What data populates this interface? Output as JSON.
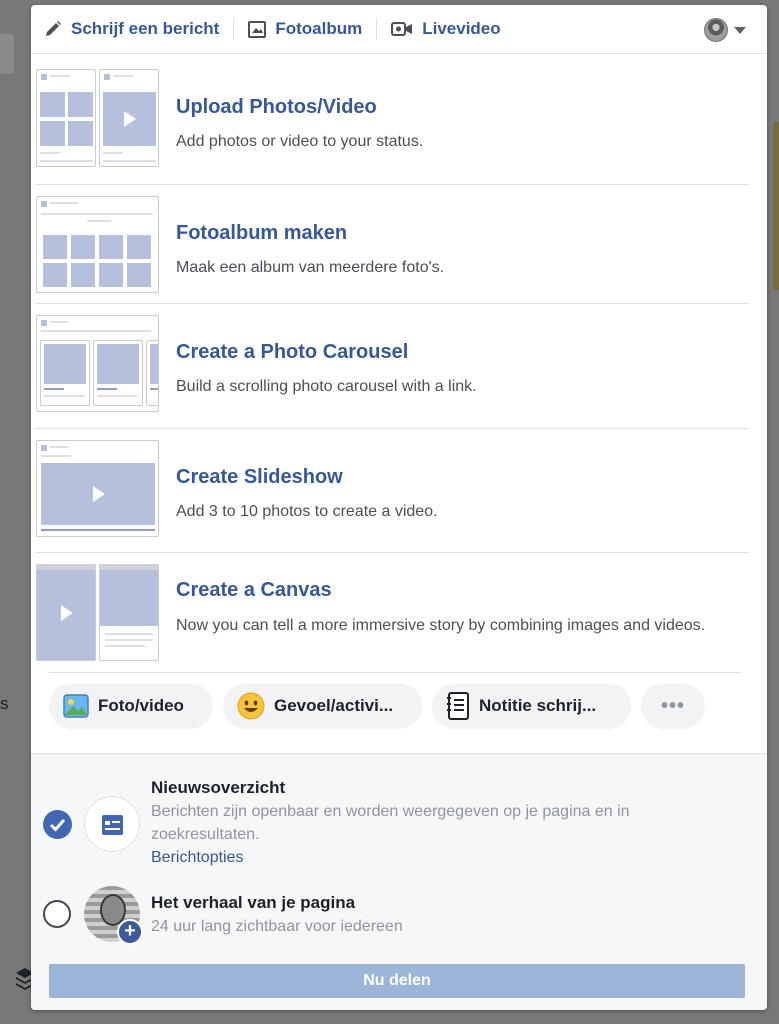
{
  "tabs": [
    {
      "label": "Schrijf een bericht",
      "icon": "pencil-icon"
    },
    {
      "label": "Fotoalbum",
      "icon": "photo-icon"
    },
    {
      "label": "Livevideo",
      "icon": "video-camera-icon"
    }
  ],
  "options": [
    {
      "title": "Upload Photos/Video",
      "description": "Add photos or video to your status."
    },
    {
      "title": "Fotoalbum maken",
      "description": "Maak een album van meerdere foto's."
    },
    {
      "title": "Create a Photo Carousel",
      "description": "Build a scrolling photo carousel with a link."
    },
    {
      "title": "Create Slideshow",
      "description": "Add 3 to 10 photos to create a video."
    },
    {
      "title": "Create a Canvas",
      "description": "Now you can tell a more immersive story by combining images and videos."
    }
  ],
  "pills": [
    {
      "label": "Foto/video",
      "icon": "photo-landscape-icon"
    },
    {
      "label": "Gevoel/activi...",
      "icon": "smiley-icon"
    },
    {
      "label": "Notitie schrij...",
      "icon": "notebook-icon"
    },
    {
      "label": "•••",
      "icon": "more-icon"
    }
  ],
  "destinations": {
    "feed": {
      "title": "Nieuwsoverzicht",
      "description": "Berichten zijn openbaar en worden weergegeven op je pagina en in zoekresultaten.",
      "link": "Berichtopties",
      "checked": true
    },
    "story": {
      "title": "Het verhaal van je pagina",
      "description": "24 uur lang zichtbaar voor iedereen",
      "checked": false
    }
  },
  "share_button": "Nu delen",
  "background": {
    "left_char": "s"
  },
  "colors": {
    "link_blue": "#365899",
    "thumb_blue": "#b6bfdc",
    "share_disabled": "#9cb4d8",
    "check_blue": "#4267b2"
  }
}
